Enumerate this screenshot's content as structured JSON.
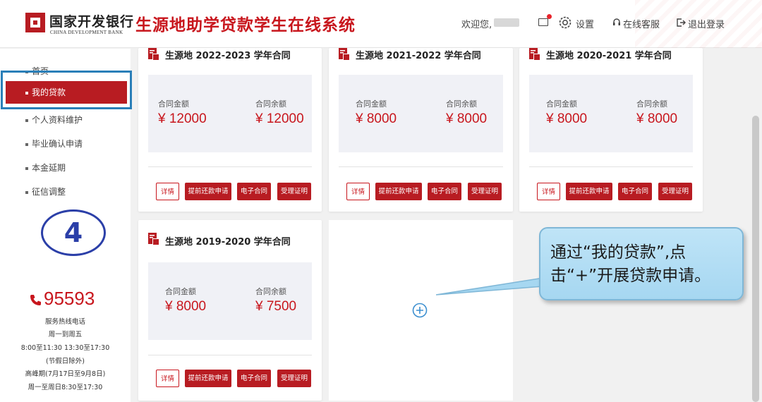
{
  "header": {
    "bank_name_cn": "国家开发银行",
    "bank_name_en": "CHINA DEVELOPMENT BANK",
    "system_title": "生源地助学贷款学生在线系统",
    "welcome": "欢迎您,",
    "settings": "设置",
    "service": "在线客服",
    "logout": "退出登录"
  },
  "sidebar": {
    "items": [
      {
        "label": "首页"
      },
      {
        "label": "我的贷款"
      },
      {
        "label": "个人资料维护"
      },
      {
        "label": "毕业确认申请"
      },
      {
        "label": "本金延期"
      },
      {
        "label": "征信调整"
      }
    ],
    "step_number": "4",
    "hotline": "95593",
    "info_lines": [
      "服务热线电话",
      "周一到周五",
      "8:00至11:30 13:30至17:30",
      "(节假日除外)",
      "高峰期(7月17日至9月8日)",
      "周一至周日8:30至17:30"
    ]
  },
  "cards": [
    {
      "title": "生源地 2022-2023 学年合同",
      "amount_label": "合同金额",
      "amount": "¥ 12000",
      "balance_label": "合同余额",
      "balance": "¥ 12000"
    },
    {
      "title": "生源地 2021-2022 学年合同",
      "amount_label": "合同金额",
      "amount": "¥ 8000",
      "balance_label": "合同余额",
      "balance": "¥ 8000"
    },
    {
      "title": "生源地 2020-2021 学年合同",
      "amount_label": "合同金额",
      "amount": "¥ 8000",
      "balance_label": "合同余额",
      "balance": "¥ 8000"
    },
    {
      "title": "生源地 2019-2020 学年合同",
      "amount_label": "合同金额",
      "amount": "¥ 8000",
      "balance_label": "合同余额",
      "balance": "¥ 7500"
    }
  ],
  "buttons": {
    "details": "详情",
    "early_repay": "提前还款申请",
    "e_contract": "电子合同",
    "acceptance": "受理证明"
  },
  "callout": {
    "line1": "通过“我的贷款”,点",
    "line2": "击“+”开展贷款申请。"
  },
  "colors": {
    "brand_red": "#b81c22",
    "highlight_blue": "#2a7fb8",
    "callout_blue": "#bfe4f7"
  }
}
